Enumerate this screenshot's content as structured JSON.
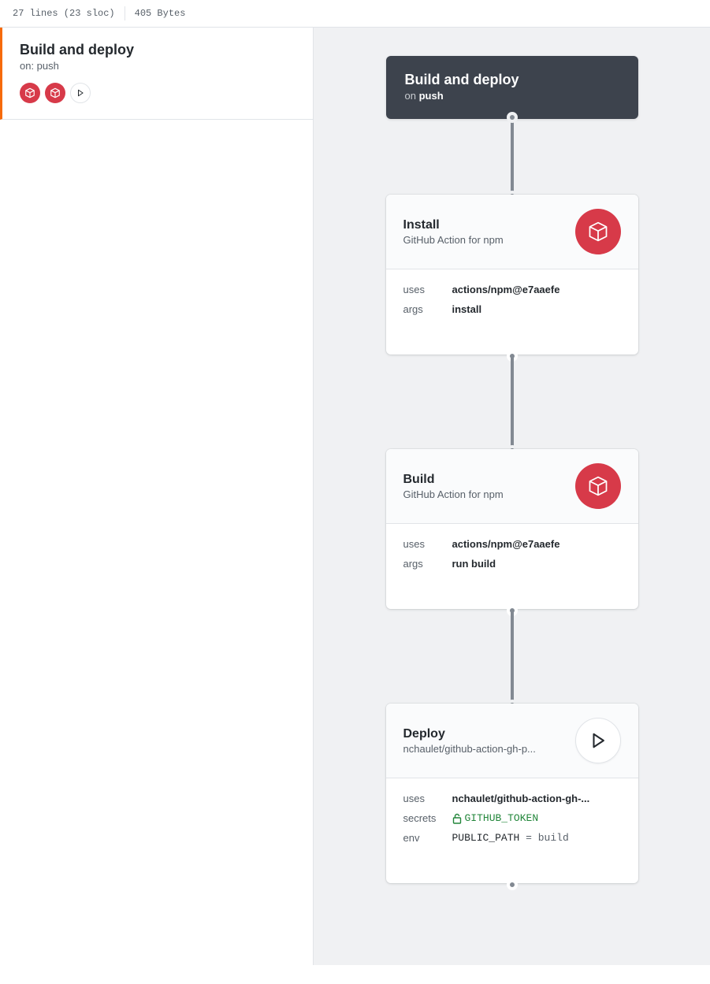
{
  "fileInfo": {
    "lines": "27 lines (23 sloc)",
    "size": "405 Bytes"
  },
  "sidebar": {
    "workflow": {
      "title": "Build and deploy",
      "trigger": "on: push"
    }
  },
  "header": {
    "title": "Build and deploy",
    "trigger_prefix": "on ",
    "trigger_event": "push"
  },
  "actions": [
    {
      "title": "Install",
      "subtitle": "GitHub Action for npm",
      "icon": "package",
      "rows": [
        {
          "k": "uses",
          "v": "actions/npm@e7aaefe",
          "type": "bold"
        },
        {
          "k": "args",
          "v": "install",
          "type": "bold"
        }
      ]
    },
    {
      "title": "Build",
      "subtitle": "GitHub Action for npm",
      "icon": "package",
      "rows": [
        {
          "k": "uses",
          "v": "actions/npm@e7aaefe",
          "type": "bold"
        },
        {
          "k": "args",
          "v": "run build",
          "type": "bold"
        }
      ]
    },
    {
      "title": "Deploy",
      "subtitle": "nchaulet/github-action-gh-p...",
      "icon": "play",
      "rows": [
        {
          "k": "uses",
          "v": "nchaulet/github-action-gh-...",
          "type": "bold"
        },
        {
          "k": "secrets",
          "v": "GITHUB_TOKEN",
          "type": "secret"
        },
        {
          "k": "env",
          "key": "PUBLIC_PATH",
          "eq": " = ",
          "val": "build",
          "type": "env"
        }
      ]
    }
  ]
}
